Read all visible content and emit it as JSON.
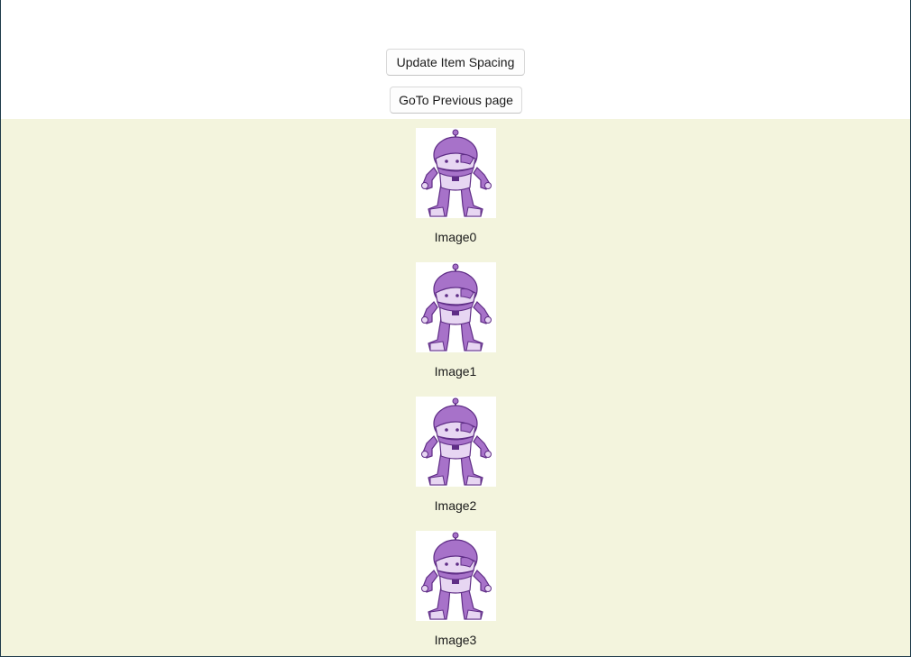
{
  "header": {
    "update_spacing_label": "Update Item Spacing",
    "goto_previous_label": "GoTo Previous page"
  },
  "list": {
    "background_color": "#f3f4dd",
    "items": [
      {
        "label": "Image0",
        "icon": "robot-icon"
      },
      {
        "label": "Image1",
        "icon": "robot-icon"
      },
      {
        "label": "Image2",
        "icon": "robot-icon"
      },
      {
        "label": "Image3",
        "icon": "robot-icon"
      }
    ]
  },
  "colors": {
    "robot_primary": "#a772c9",
    "robot_dark": "#5f2d86",
    "robot_light": "#e7d6f2"
  }
}
